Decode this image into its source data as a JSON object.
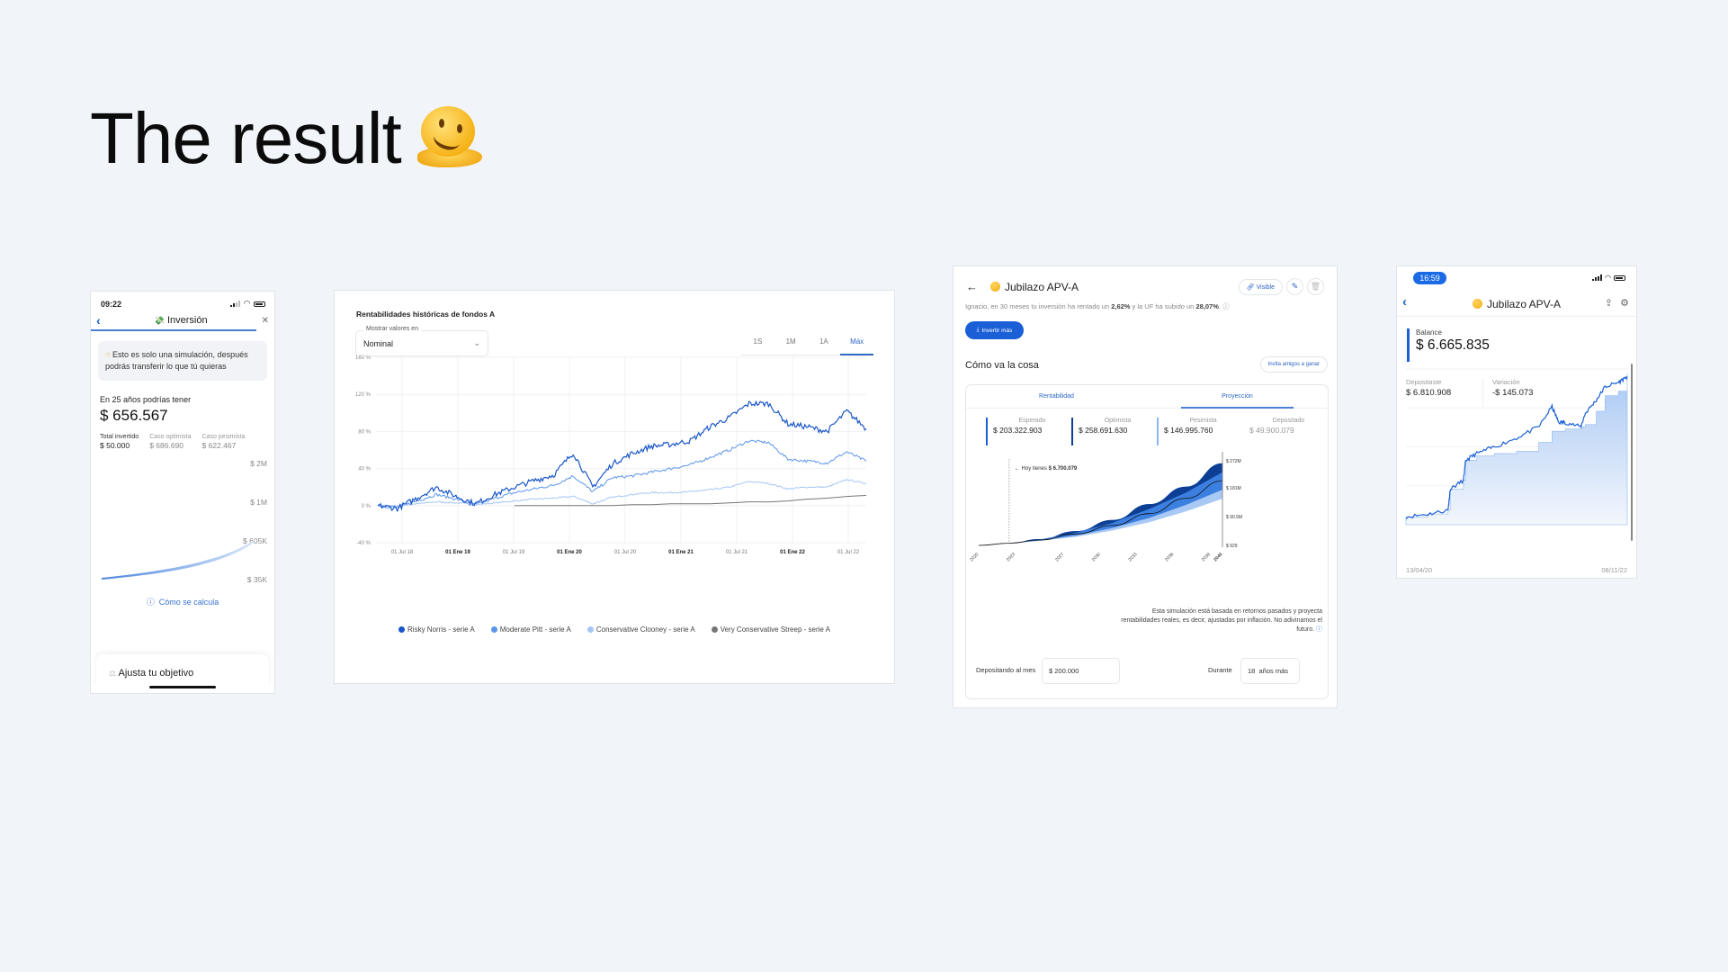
{
  "page": {
    "title": "The result",
    "title_emoji": "melting-face"
  },
  "mobile_simulation": {
    "status_time": "09:22",
    "nav_title": "Inversión",
    "nav_emoji": "money-with-wings",
    "note": "Esto es solo una simulación, después podrás transferir lo que tú quieras",
    "subtitle": "En 25 años podrías tener",
    "amount": "$ 656.567",
    "stats": [
      {
        "label": "Total invertido",
        "value": "$ 50.000"
      },
      {
        "label": "Caso optimista",
        "value": "$ 686.690"
      },
      {
        "label": "Caso pesimista",
        "value": "$ 622.467"
      }
    ],
    "y_labels": [
      "$ 2M",
      "$ 1M",
      "$ 605K",
      "$ 35K"
    ],
    "how_link": "Cómo se calcula",
    "adjust_card": "Ajusta tu objetivo"
  },
  "historical_chart": {
    "title": "Rentabilidades históricas de fondos A",
    "select_label": "Mostrar valores en",
    "select_value": "Nominal",
    "ranges": [
      {
        "label": "1S",
        "active": false
      },
      {
        "label": "1M",
        "active": false
      },
      {
        "label": "1A",
        "active": false
      },
      {
        "label": "Máx",
        "active": true
      }
    ]
  },
  "projection_panel": {
    "title": "Jubilazo APV-A",
    "visible_label": "Visible",
    "description_pre": "Ignacio, en 30 meses tu inversión ha rentado un ",
    "return_pct": "2,62%",
    "description_mid": " y la UF ha subido un ",
    "uf_pct": "28,07%",
    "description_post": ".",
    "invest_button": "Invertir más",
    "section_title": "Cómo va la cosa",
    "invite_button": "Invita amigos a ganar",
    "tabs": [
      {
        "label": "Rentabilidad",
        "active": false
      },
      {
        "label": "Proyección",
        "active": true
      }
    ],
    "kpis": [
      {
        "label": "Esperado",
        "value": "$ 203.322.903",
        "color": "#1a5fd6"
      },
      {
        "label": "Optimista",
        "value": "$ 258.691.630",
        "color": "#0d3f94"
      },
      {
        "label": "Pesimista",
        "value": "$ 146.995.760",
        "color": "#8ab6f2"
      },
      {
        "label": "Depositado",
        "value": "$ 49.900.079",
        "color": ""
      }
    ],
    "today_label": "← Hoy tienes",
    "today_value": "$ 6.700.079",
    "disclaimer": "Esta simulación está basada en retornos pasados y proyecta rentabilidades reales, es decir, ajustadas por inflación. No adivinamos el futuro.",
    "monthly_label": "Depositando al mes",
    "monthly_value": "$ 200.000",
    "duration_label": "Durante",
    "duration_value": "18  años más"
  },
  "balance_panel": {
    "status_time": "16:59",
    "title": "Jubilazo APV-A",
    "balance_label": "Balance",
    "balance_value": "$ 6.665.835",
    "deposited_label": "Depositaste",
    "deposited_value": "$ 6.810.908",
    "variation_label": "Variación",
    "variation_value": "-$ 145.073",
    "x_start": "13/04/20",
    "x_end": "08/11/22"
  },
  "chart_data": [
    {
      "type": "line",
      "title": "Rentabilidades históricas de fondos A",
      "xlabel": "",
      "ylabel": "",
      "x_tick_labels": [
        "01 Jul 18",
        "01 Ene 19",
        "01 Jul 19",
        "01 Ene 20",
        "01 Jul 20",
        "01 Ene 21",
        "01 Jul 21",
        "01 Ene 22",
        "01 Jul 22"
      ],
      "x_tick_bold": [
        false,
        true,
        false,
        true,
        false,
        true,
        false,
        true,
        false
      ],
      "y_tick_labels": [
        "160 %",
        "120 %",
        "80 %",
        "40 %",
        "0 %",
        "-40 %"
      ],
      "y_ticks": [
        160,
        120,
        80,
        40,
        0,
        -40
      ],
      "ylim": [
        -40,
        160
      ],
      "x": [
        "Feb 18",
        "Abr 18",
        "Jul 18",
        "Oct 18",
        "Dic 18",
        "Ene 19",
        "Abr 19",
        "Jul 19",
        "Oct 19",
        "Dic 19",
        "Feb 20",
        "Mar 20",
        "Abr 20",
        "Jul 20",
        "Oct 20",
        "Ene 21",
        "Abr 21",
        "Jul 21",
        "Oct 21",
        "Dic 21",
        "Ene 22",
        "Mar 22",
        "May 22",
        "Jul 22",
        "Sep 22",
        "Oct 22"
      ],
      "series": [
        {
          "name": "Risky Norris - serie A",
          "color": "#1a56c8",
          "values": [
            0,
            -3,
            8,
            20,
            10,
            2,
            12,
            20,
            27,
            33,
            57,
            20,
            45,
            56,
            64,
            66,
            70,
            85,
            95,
            110,
            110,
            88,
            85,
            80,
            102,
            83
          ]
        },
        {
          "name": "Moderate Pitt - serie A",
          "color": "#5b95ea",
          "values": [
            0,
            -2,
            5,
            12,
            7,
            1,
            8,
            14,
            18,
            22,
            32,
            15,
            30,
            32,
            36,
            40,
            44,
            52,
            60,
            70,
            68,
            50,
            48,
            46,
            58,
            48
          ]
        },
        {
          "name": "Conservative Clooney - serie A",
          "color": "#a5c6f5",
          "values": [
            0,
            0,
            2,
            4,
            3,
            1,
            3,
            5,
            7,
            8,
            10,
            2,
            9,
            12,
            14,
            14,
            15,
            17,
            20,
            26,
            24,
            18,
            20,
            20,
            28,
            24
          ]
        },
        {
          "name": "Very Conservative Streep - serie A",
          "color": "#777777",
          "values": [
            null,
            null,
            null,
            null,
            null,
            null,
            null,
            0,
            0,
            0,
            0,
            0,
            0,
            1,
            1,
            2,
            2,
            2,
            3,
            4,
            4,
            5,
            7,
            8,
            10,
            11
          ]
        }
      ],
      "legend": "bottom"
    },
    {
      "type": "area",
      "title": "Proyección",
      "x_tick_labels": [
        "2020",
        "2023",
        "2027",
        "2030",
        "2033",
        "2036",
        "2039",
        "2040"
      ],
      "y_tick_labels": [
        "$ 272M",
        "$ 181M",
        "$ 90.5M",
        "$ 929"
      ],
      "ylim": [
        0,
        272000000
      ],
      "today_year": 2022.5,
      "x": [
        2020,
        2022.5,
        2025,
        2028,
        2031,
        2034,
        2037,
        2040
      ],
      "series": [
        {
          "name": "Optimista",
          "color": "#0d3f94",
          "values": [
            0,
            6700079,
            20000000,
            45000000,
            80000000,
            130000000,
            185000000,
            258691630
          ]
        },
        {
          "name": "Esperado",
          "color": "#1a1a1a",
          "values": [
            0,
            6700079,
            17000000,
            36000000,
            63000000,
            100000000,
            148000000,
            203322903
          ]
        },
        {
          "name": "Pesimista",
          "color": "#8ab6f2",
          "values": [
            0,
            6700079,
            14000000,
            27000000,
            47000000,
            73000000,
            107000000,
            146995760
          ]
        }
      ]
    },
    {
      "type": "area",
      "title": "Balance",
      "x_tick_labels": [
        "13/04/20",
        "08/11/22"
      ],
      "x": [
        0,
        0.1,
        0.19,
        0.2,
        0.26,
        0.27,
        0.32,
        0.4,
        0.5,
        0.6,
        0.66,
        0.69,
        0.72,
        0.79,
        0.81,
        0.86,
        0.9,
        0.96,
        1.0
      ],
      "series": [
        {
          "name": "Balance",
          "color": "#1a5fd6",
          "values": [
            0.35,
            0.48,
            0.65,
            1.6,
            2.0,
            2.9,
            3.2,
            3.5,
            3.9,
            4.4,
            5.3,
            4.6,
            4.6,
            4.4,
            5.0,
            5.6,
            6.2,
            6.4,
            6.67
          ]
        },
        {
          "name": "Depositado",
          "color": "#8fb6ee",
          "values": [
            0.35,
            0.48,
            0.65,
            1.6,
            2.0,
            2.9,
            3.1,
            3.2,
            3.3,
            3.7,
            4.2,
            4.2,
            4.3,
            4.4,
            4.5,
            5.1,
            5.8,
            6.0,
            6.81
          ]
        }
      ]
    }
  ]
}
